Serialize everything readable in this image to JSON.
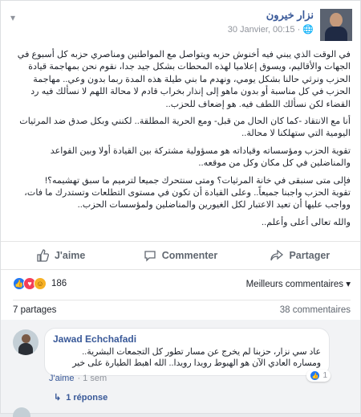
{
  "post": {
    "author": "نزار خيرون",
    "timestamp": "30 Janvier, 00:15 · ",
    "paragraphs": [
      "في الوقت الذي يبني فيه أخنوش حزبه ويتواصل مع المواطنين ومناصري حزبه كل أسبوع في الجهات والأقاليم، ويسوق إعلاميا لهذه المحطات بشكل جيد جدا، نقوم نحن بمهاجمة قيادة الحزب ونرثي حالنا بشكل يومي، ونهدم ما بني طيلة هذه المدة ربما بدون وعي.. مهاجمة الحزب في كل مناسبة أو بدون ماهو إلى إنذار بخراب قادم لا محالة اللهم لا نسألك فيه رد القضاء لكن نسألك اللطف فيه. هو إضعاف للحزب..",
      "أنا مع الانتقاد -كما كان الحال من قبل- ومع الحرية المطلقة.. لكنني وبكل صدق ضد المرثيات اليومية التي ستهلكنا لا محالة..",
      "تقوية الحزب ومؤسساته وقياداته هو مسؤولية مشتركة بين القيادة أولا وبين القواعد والمناضلين في كل مكان وكل من موقعه..",
      "فإلى متى سنبقى في خانة المرثيات؟ ومتى سنتحرك جميعا لترميم ما سبق تهشيمه؟!\nتقوية الحزب واجبنا جميعاً.. وعلى القيادة أن تكون في مستوى التطلعات وتستدرك ما فات، وواجب عليها أن تعيد الاعتبار لكل الغيورين والمناضلين ولمؤسسات الحزب..",
      "والله تعالى أعلى وأعلم.."
    ]
  },
  "actions": {
    "like": "J'aime",
    "comment": "Commenter",
    "share": "Partager"
  },
  "stats": {
    "reaction_count": "186",
    "sort_label": "Meilleurs commentaires ▾",
    "shares": "7 partages",
    "comments": "38 commentaires"
  },
  "comment": {
    "author": "Jawad Echchafadi",
    "text": "عاد سي نزار، حزبنا لم يخرج عن مسار تطور كل التجمعات البشرية.. ومساره العادي الآن هو الهبوط رويدا رويدا.. الله اهبط الطيارة على خير",
    "like_count": "1",
    "like_label": "J'aime",
    "age": "· 1 sem",
    "reply_label": "1 réponse"
  },
  "colors": {
    "link": "#385898",
    "like": "#2078f4",
    "love": "#f33e58",
    "haha": "#f7b125"
  }
}
